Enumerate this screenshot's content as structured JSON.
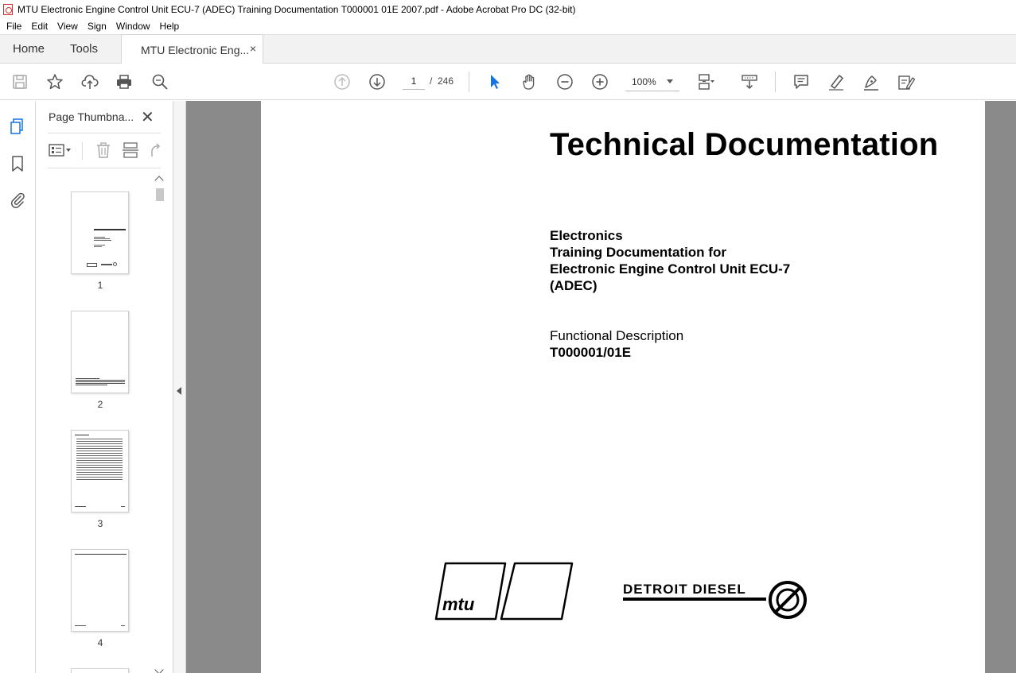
{
  "window": {
    "title": "MTU Electronic Engine Control Unit ECU-7 (ADEC) Training Documentation T000001 01E 2007.pdf - Adobe Acrobat Pro DC (32-bit)"
  },
  "menu": [
    "File",
    "Edit",
    "View",
    "Sign",
    "Window",
    "Help"
  ],
  "tabs": {
    "home": "Home",
    "tools": "Tools",
    "document": "MTU Electronic Eng...",
    "close_glyph": "×"
  },
  "toolbar": {
    "page_current": "1",
    "page_sep": "/",
    "page_total": "246",
    "zoom": "100%",
    "icons": [
      "save-icon",
      "star-icon",
      "upload-icon",
      "print-icon",
      "search-icon",
      "page-up-icon",
      "page-down-icon",
      "select-cursor-icon",
      "hand-icon",
      "zoom-out-icon",
      "zoom-in-icon",
      "fit-page-icon",
      "scroll-mode-icon",
      "comment-icon",
      "highlight-icon",
      "sign-icon",
      "edit-icon"
    ]
  },
  "left_rail": {
    "icons": [
      "page-thumbnails-icon",
      "bookmark-icon",
      "attachment-icon"
    ]
  },
  "thumbnail_panel": {
    "title": "Page Thumbna...",
    "close_glyph": "✕",
    "pages": [
      "1",
      "2",
      "3",
      "4"
    ]
  },
  "document": {
    "title": "Technical Documentation",
    "lines": [
      "Electronics",
      "Training Documentation for",
      "Electronic Engine Control Unit ECU-7",
      "(ADEC)"
    ],
    "subtitle": "Functional Description",
    "doc_number": "T000001/01E",
    "logo_mtu_text": "mtu",
    "logo_dd_text": "DETROIT DIESEL"
  },
  "colors": {
    "accent": "#1473e6",
    "doc_background": "#8a8a8a",
    "tab_bar": "#f2f2f2"
  }
}
